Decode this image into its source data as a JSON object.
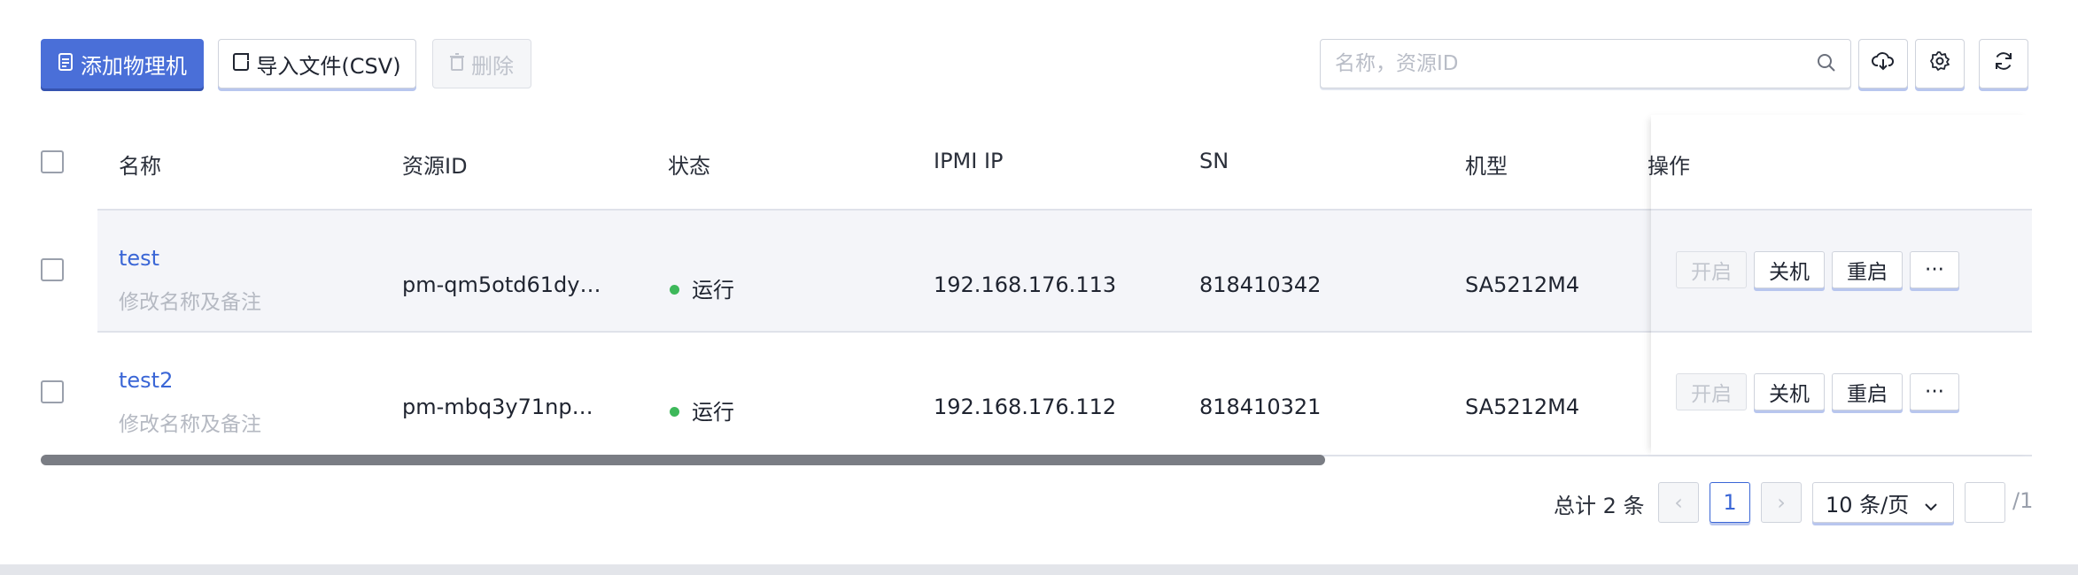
{
  "toolbar": {
    "add_label": "添加物理机",
    "import_label": "导入文件(CSV)",
    "delete_label": "删除",
    "search_placeholder": "名称，资源ID"
  },
  "table": {
    "columns": [
      "名称",
      "资源ID",
      "状态",
      "IPMI IP",
      "SN",
      "机型",
      "操作"
    ],
    "rows": [
      {
        "name": "test",
        "note": "修改名称及备注",
        "resource_id": "pm-qm5otd61dy…",
        "status": "运行",
        "ipmi_ip": "192.168.176.113",
        "sn": "818410342",
        "model": "SA5212M4",
        "actions": {
          "start": "开启",
          "shutdown": "关机",
          "restart": "重启",
          "more": "···"
        }
      },
      {
        "name": "test2",
        "note": "修改名称及备注",
        "resource_id": "pm-mbq3y71np…",
        "status": "运行",
        "ipmi_ip": "192.168.176.112",
        "sn": "818410321",
        "model": "SA5212M4",
        "actions": {
          "start": "开启",
          "shutdown": "关机",
          "restart": "重启",
          "more": "···"
        }
      }
    ]
  },
  "pagination": {
    "total": "总计 2 条",
    "prev": "‹",
    "current": "1",
    "next": "›",
    "page_size": "10 条/页",
    "page_count": "/1"
  },
  "colors": {
    "primary": "#4a6fd8",
    "link": "#3a66d6",
    "status_running": "#3db85a"
  },
  "icons": {
    "add": "document-icon",
    "import": "file-import-icon",
    "delete": "trash-icon",
    "search": "search-icon",
    "download": "cloud-download-icon",
    "settings": "gear-icon",
    "refresh": "refresh-icon"
  }
}
